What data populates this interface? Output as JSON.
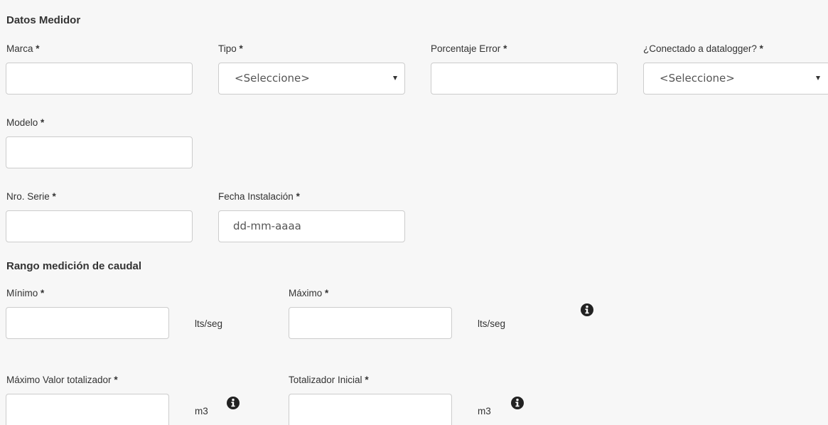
{
  "section_meter": {
    "title": "Datos Medidor"
  },
  "fields": {
    "marca": {
      "label": "Marca",
      "value": ""
    },
    "tipo": {
      "label": "Tipo",
      "selected": "<Seleccione>"
    },
    "porcentaje_error": {
      "label": "Porcentaje Error",
      "value": ""
    },
    "conectado": {
      "label": "¿Conectado a datalogger?",
      "selected": "<Seleccione>"
    },
    "modelo": {
      "label": "Modelo",
      "value": ""
    },
    "nro_serie": {
      "label": "Nro. Serie",
      "value": ""
    },
    "fecha_instalacion": {
      "label": "Fecha Instalación",
      "placeholder": "dd-mm-aaaa"
    }
  },
  "required_marker": "*",
  "section_range": {
    "title": "Rango medición de caudal"
  },
  "range": {
    "minimo": {
      "label": "Mínimo",
      "unit": "lts/seg"
    },
    "maximo": {
      "label": "Máximo",
      "unit": "lts/seg"
    }
  },
  "totalizer": {
    "max_valor": {
      "label": "Máximo Valor totalizador",
      "unit": "m3"
    },
    "inicial": {
      "label": "Totalizador Inicial",
      "unit": "m3"
    }
  },
  "icons": {
    "info": "info-circle-icon"
  }
}
